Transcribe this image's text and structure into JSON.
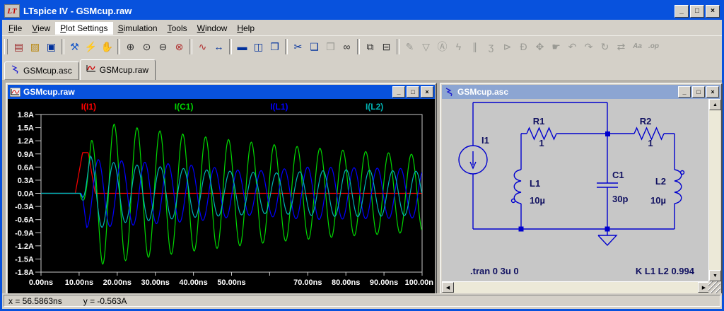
{
  "window": {
    "title": "LTspice IV - GSMcup.raw",
    "logo_text": "LT",
    "controls": [
      {
        "name": "minimize-button",
        "glyph": "_"
      },
      {
        "name": "maximize-button",
        "glyph": "□"
      },
      {
        "name": "close-button",
        "glyph": "×"
      }
    ]
  },
  "menu": {
    "items": [
      {
        "label": "File",
        "open": false
      },
      {
        "label": "View",
        "open": false
      },
      {
        "label": "Plot Settings",
        "open": true
      },
      {
        "label": "Simulation",
        "open": false
      },
      {
        "label": "Tools",
        "open": false
      },
      {
        "label": "Window",
        "open": false
      },
      {
        "label": "Help",
        "open": false
      }
    ]
  },
  "toolbar": {
    "groups": [
      [
        {
          "name": "new-schematic",
          "glyph": "▤",
          "color": "#a03030",
          "enabled": true
        },
        {
          "name": "open",
          "glyph": "▨",
          "color": "#b8860b",
          "enabled": true
        },
        {
          "name": "save",
          "glyph": "▣",
          "color": "#00309c",
          "enabled": true
        }
      ],
      [
        {
          "name": "control-panel",
          "glyph": "⚒",
          "color": "#1a5ac8",
          "enabled": true
        },
        {
          "name": "run",
          "glyph": "⚡",
          "color": "#303030",
          "enabled": true
        },
        {
          "name": "halt",
          "glyph": "✋",
          "color": "#9a9a94",
          "enabled": false
        }
      ],
      [
        {
          "name": "zoom-in",
          "glyph": "⊕",
          "color": "#303030",
          "enabled": true
        },
        {
          "name": "zoom-back",
          "glyph": "⊙",
          "color": "#303030",
          "enabled": true
        },
        {
          "name": "zoom-out",
          "glyph": "⊖",
          "color": "#303030",
          "enabled": true
        },
        {
          "name": "zoom-full-extents",
          "glyph": "⊗",
          "color": "#b03030",
          "enabled": true
        }
      ],
      [
        {
          "name": "plot-settings",
          "glyph": "∿",
          "color": "#b03030",
          "enabled": true
        },
        {
          "name": "autorange",
          "glyph": "↔",
          "color": "#00309c",
          "enabled": true
        }
      ],
      [
        {
          "name": "tile-horizontally",
          "glyph": "▬",
          "color": "#00309c",
          "enabled": true
        },
        {
          "name": "tile-vertically",
          "glyph": "◫",
          "color": "#00309c",
          "enabled": true
        },
        {
          "name": "cascade-windows",
          "glyph": "❐",
          "color": "#00309c",
          "enabled": true
        }
      ],
      [
        {
          "name": "cut",
          "glyph": "✂",
          "color": "#00309c",
          "enabled": true
        },
        {
          "name": "copy",
          "glyph": "❑",
          "color": "#00309c",
          "enabled": true
        },
        {
          "name": "paste",
          "glyph": "❒",
          "color": "#9a9a94",
          "enabled": false
        },
        {
          "name": "find",
          "glyph": "∞",
          "color": "#303030",
          "enabled": true
        }
      ],
      [
        {
          "name": "print-preview",
          "glyph": "⧉",
          "color": "#303030",
          "enabled": true
        },
        {
          "name": "print",
          "glyph": "⊟",
          "color": "#303030",
          "enabled": true
        }
      ],
      [
        {
          "name": "draw-wire",
          "glyph": "✎",
          "color": "#9a9a94",
          "enabled": false
        },
        {
          "name": "place-ground",
          "glyph": "▽",
          "color": "#9a9a94",
          "enabled": false
        },
        {
          "name": "net-label",
          "glyph": "Ⓐ",
          "color": "#9a9a94",
          "enabled": false
        },
        {
          "name": "place-resistor",
          "glyph": "ϟ",
          "color": "#9a9a94",
          "enabled": false
        },
        {
          "name": "place-capacitor",
          "glyph": "∥",
          "color": "#9a9a94",
          "enabled": false
        },
        {
          "name": "place-inductor",
          "glyph": "ʒ",
          "color": "#9a9a94",
          "enabled": false
        },
        {
          "name": "place-diode",
          "glyph": "⊳",
          "color": "#9a9a94",
          "enabled": false
        },
        {
          "name": "place-component",
          "glyph": "Ð",
          "color": "#9a9a94",
          "enabled": false
        },
        {
          "name": "move",
          "glyph": "✥",
          "color": "#9a9a94",
          "enabled": false
        },
        {
          "name": "drag",
          "glyph": "☛",
          "color": "#9a9a94",
          "enabled": false
        },
        {
          "name": "undo",
          "glyph": "↶",
          "color": "#9a9a94",
          "enabled": false
        },
        {
          "name": "redo",
          "glyph": "↷",
          "color": "#9a9a94",
          "enabled": false
        },
        {
          "name": "rotate",
          "glyph": "↻",
          "color": "#9a9a94",
          "enabled": false
        },
        {
          "name": "mirror",
          "glyph": "⇄",
          "color": "#9a9a94",
          "enabled": false
        },
        {
          "name": "add-text",
          "glyph": "Aa",
          "color": "#9a9a94",
          "enabled": false,
          "text_glyph": true
        },
        {
          "name": "spice-directive",
          "glyph": ".op",
          "color": "#9a9a94",
          "enabled": false,
          "text_glyph": true
        }
      ]
    ]
  },
  "tabs": [
    {
      "label": "GSMcup.asc",
      "icon": "schematic-icon",
      "active": false
    },
    {
      "label": "GSMcup.raw",
      "icon": "waveform-icon",
      "active": true
    }
  ],
  "waveform_window": {
    "title": "GSMcup.raw"
  },
  "chart_data": {
    "type": "line",
    "title": "GSMcup.raw",
    "xlabel": "time",
    "ylabel": "current",
    "x_unit": "ns",
    "y_unit": "A",
    "x_range_ns": [
      0,
      100
    ],
    "y_range_A": [
      -1.8,
      1.8
    ],
    "grid": false,
    "legend_position": "top",
    "x_ticks_ns": [
      0,
      10,
      20,
      30,
      40,
      50,
      60,
      70,
      80,
      90,
      100
    ],
    "x_tick_labels": [
      "0.00ns",
      "10.00ns",
      "20.00ns",
      "30.00ns",
      "40.00ns",
      "50.00ns",
      "",
      "70.00ns",
      "80.00ns",
      "90.00ns",
      "100.00n"
    ],
    "y_ticks_A": [
      1.8,
      1.5,
      1.2,
      0.9,
      0.6,
      0.3,
      0.0,
      -0.3,
      -0.6,
      -0.9,
      -1.2,
      -1.5,
      -1.8
    ],
    "y_tick_labels": [
      "1.8A",
      "1.5A",
      "1.2A",
      "0.9A",
      "0.6A",
      "0.3A",
      "0.0A",
      "-0.3A",
      "-0.6A",
      "-0.9A",
      "-1.2A",
      "-1.5A",
      "-1.8A"
    ],
    "series": [
      {
        "name": "I(I1)",
        "color": "#ff0000",
        "model": "piecewise-linear",
        "points_ns_A": [
          [
            0,
            0
          ],
          [
            9,
            0
          ],
          [
            10.9,
            0.93
          ],
          [
            12.4,
            0.93
          ],
          [
            14.2,
            0
          ],
          [
            100,
            0
          ]
        ]
      },
      {
        "name": "I(C1)",
        "color": "#00d800",
        "model": "modulated-oscillation",
        "period_ns": 6.0,
        "start_ns": 10.2,
        "phase_deg": -90,
        "amplitude_envelope_ns_A": [
          [
            10.2,
            0
          ],
          [
            12,
            0.55
          ],
          [
            13.2,
            1.2
          ],
          [
            16,
            1.62
          ],
          [
            25,
            1.5
          ],
          [
            40,
            1.32
          ],
          [
            60,
            1.12
          ],
          [
            80,
            0.98
          ],
          [
            100,
            0.88
          ]
        ]
      },
      {
        "name": "I(L1)",
        "color": "#0000ff",
        "model": "modulated-oscillation",
        "period_ns": 6.1,
        "start_ns": 10.4,
        "phase_deg": 176,
        "amplitude_envelope_ns_A": [
          [
            10.4,
            0
          ],
          [
            12,
            0.78
          ],
          [
            20,
            0.75
          ],
          [
            40,
            0.64
          ],
          [
            55,
            0.5
          ],
          [
            70,
            0.6
          ],
          [
            100,
            0.56
          ]
        ]
      },
      {
        "name": "I(L2)",
        "color": "#00b4b4",
        "model": "modulated-oscillation",
        "period_ns": 6.1,
        "start_ns": 10.4,
        "phase_deg": -63,
        "amplitude_envelope_ns_A": [
          [
            10.4,
            0
          ],
          [
            13,
            0.85
          ],
          [
            20,
            0.68
          ],
          [
            40,
            0.55
          ],
          [
            60,
            0.46
          ],
          [
            80,
            0.54
          ],
          [
            100,
            0.5
          ]
        ]
      }
    ]
  },
  "schematic_window": {
    "title": "GSMcup.asc",
    "components": [
      {
        "ref": "I1",
        "value": ""
      },
      {
        "ref": "R1",
        "value": "1"
      },
      {
        "ref": "L1",
        "value": "10µ"
      },
      {
        "ref": "C1",
        "value": "30p"
      },
      {
        "ref": "R2",
        "value": "1"
      },
      {
        "ref": "L2",
        "value": "10µ"
      }
    ],
    "directives": {
      "tran": ".tran 0 3u 0",
      "coupling": "K L1 L2 0.994"
    }
  },
  "status_bar": {
    "x_readout": "x = 56.5863ns",
    "y_readout": "y = -0.563A"
  },
  "colors": {
    "active_title": "#0852dd",
    "inactive_title": "#8ca5d2",
    "chrome": "#d4d0c8",
    "plot_background": "#000000",
    "plot_frame": "#c8c8c8",
    "schematic_wire": "#0000ce",
    "schematic_text": "#101060",
    "trace_red": "#ff0000",
    "trace_green": "#00d800",
    "trace_blue": "#0000ff",
    "trace_cyan": "#00b4b4"
  }
}
